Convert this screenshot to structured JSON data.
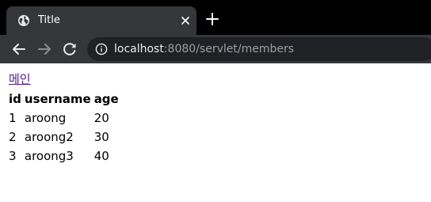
{
  "browser": {
    "tab": {
      "title": "Title",
      "favicon": "globe-icon",
      "close": "close-icon"
    },
    "new_tab": "plus-icon",
    "toolbar": {
      "back": "back-arrow-icon",
      "forward": "forward-arrow-icon",
      "reload": "reload-icon",
      "site_info": "info-icon"
    },
    "url": {
      "host": "localhost",
      "rest": ":8080/servlet/members"
    },
    "colors": {
      "tabstrip": "#000000",
      "tab_active": "#35363a",
      "omnibox": "#202124",
      "link_visited": "#551a8b"
    }
  },
  "page": {
    "main_link": "메인",
    "table": {
      "headers": [
        "id",
        "username",
        "age"
      ],
      "rows": [
        [
          "1",
          "aroong",
          "20"
        ],
        [
          "2",
          "aroong2",
          "30"
        ],
        [
          "3",
          "aroong3",
          "40"
        ]
      ]
    }
  }
}
